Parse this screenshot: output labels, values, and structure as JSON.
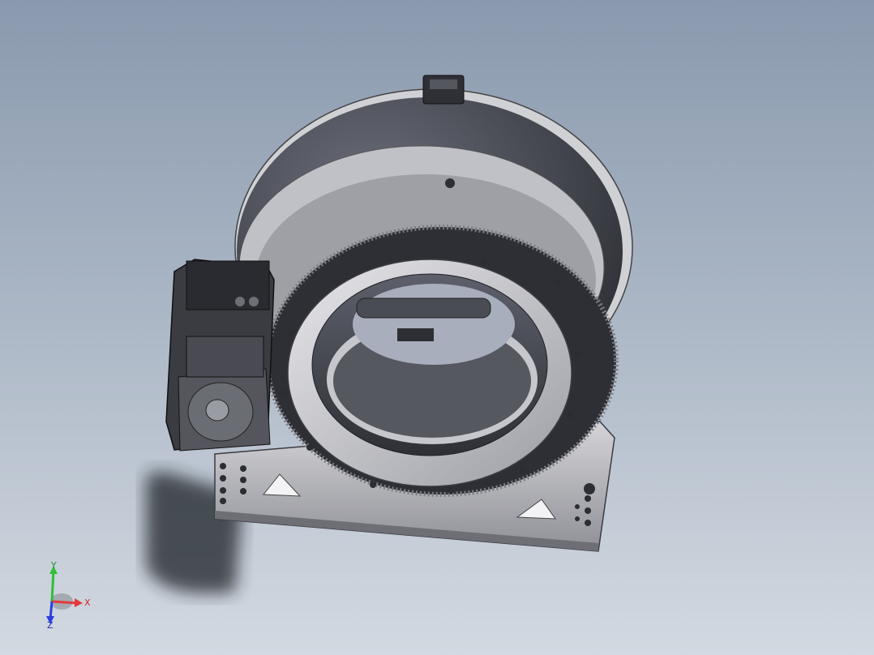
{
  "viewport": {
    "background_top": "#8a99ae",
    "background_bottom": "#d3d9e1",
    "model_name": ""
  },
  "model": {
    "housing_color": "#4c4f5a",
    "ring_color": "#c9c9cd",
    "gear_color": "#2e2f35",
    "base_plate_color": "#b7b7bb",
    "motor_color": "#3b3c42"
  },
  "triad": {
    "x_label": "X",
    "y_label": "Y",
    "z_label": "Z",
    "x_color": "#e23a3a",
    "y_color": "#2fbf3a",
    "z_color": "#2d3ee0"
  }
}
